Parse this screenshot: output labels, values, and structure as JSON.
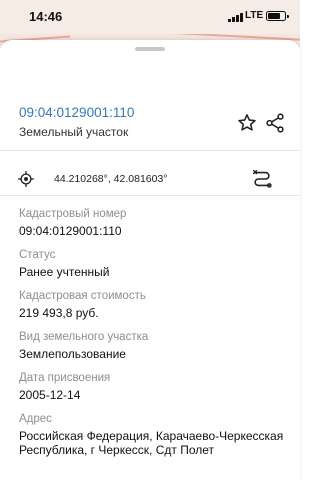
{
  "status_bar": {
    "time": "14:46",
    "network": "LTE",
    "signal_bars": 4,
    "battery_level": 0.8
  },
  "parcel": {
    "cadastral_number_link": "09:04:0129001:110",
    "type": "Земельный участок"
  },
  "location": {
    "coordinates": "44.210268°, 42.081603°"
  },
  "fields": [
    {
      "label": "Кадастровый номер",
      "value": "09:04:0129001:110"
    },
    {
      "label": "Статус",
      "value": "Ранее учтенный"
    },
    {
      "label": "Кадастровая стоимость",
      "value": "219 493,8 руб."
    },
    {
      "label": "Вид земельного участка",
      "value": "Землепользование"
    },
    {
      "label": "Дата присвоения",
      "value": "2005-12-14"
    },
    {
      "label": "Адрес",
      "value": "Российская Федерация, Карачаево-Черкесская Республика, г Черкесск, Сдт Полет"
    }
  ],
  "icons": {
    "favorite": "star-outline-icon",
    "share": "share-icon",
    "locate": "gps-crosshair-icon",
    "route": "route-icon"
  },
  "colors": {
    "link": "#2f7ac0",
    "label": "#8e8e8e",
    "status_bar_bg": "#f6ece6"
  }
}
